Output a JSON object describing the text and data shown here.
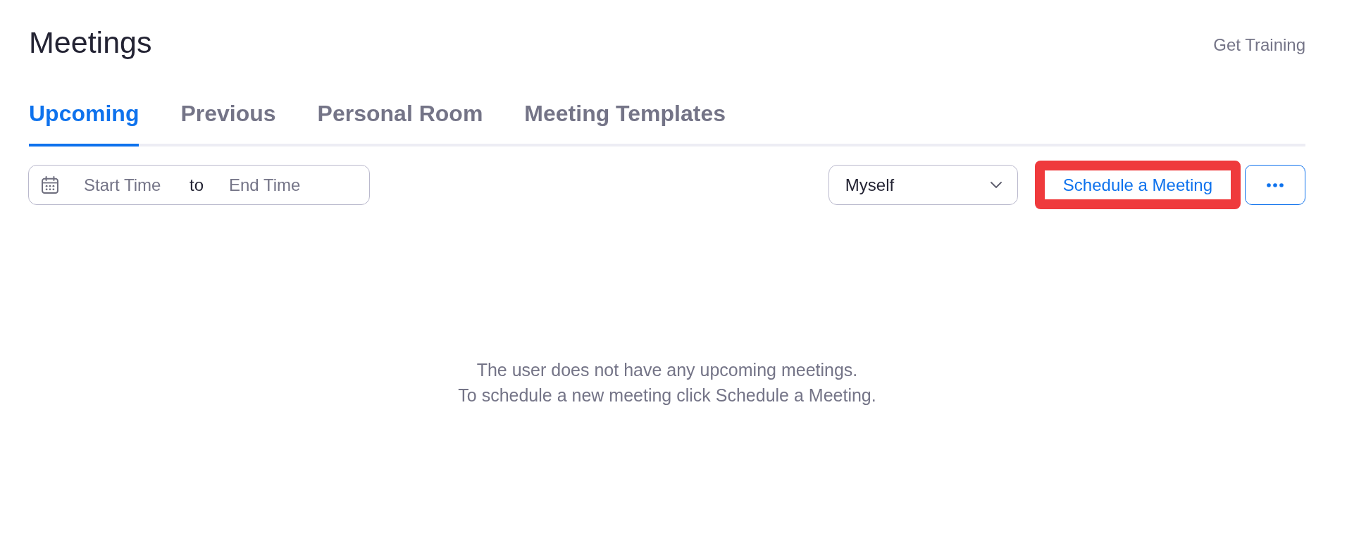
{
  "header": {
    "title": "Meetings",
    "link": "Get Training"
  },
  "tabs": [
    {
      "label": "Upcoming",
      "selected": true
    },
    {
      "label": "Previous",
      "selected": false
    },
    {
      "label": "Personal Room",
      "selected": false
    },
    {
      "label": "Meeting Templates",
      "selected": false
    }
  ],
  "toolbar": {
    "date_range": {
      "start": {
        "placeholder": "Start Time"
      },
      "separator": "to",
      "end": {
        "placeholder": "End Time"
      }
    },
    "host_filter": {
      "value": "Myself"
    },
    "schedule_button": {
      "label": "Schedule a Meeting",
      "highlighted": true
    }
  },
  "empty_state": {
    "lines": [
      "The user does not have any upcoming meetings.",
      "To schedule a new meeting click Schedule a Meeting."
    ]
  }
}
